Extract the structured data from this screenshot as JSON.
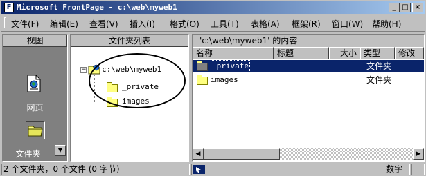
{
  "window": {
    "title": "Microsoft FrontPage - c:\\web\\myweb1",
    "app_icon_glyph": "F",
    "minimize_glyph": "_",
    "maximize_glyph": "□",
    "close_glyph": "×"
  },
  "menu": [
    "文件(F)",
    "编辑(E)",
    "查看(V)",
    "插入(I)",
    "格式(O)",
    "工具(T)",
    "表格(A)",
    "框架(R)",
    "窗口(W)",
    "帮助(H)"
  ],
  "views_bar": {
    "header": "视图",
    "items": [
      {
        "label": "网页",
        "icon": "page-icon"
      },
      {
        "label": "文件夹",
        "icon": "folder-icon",
        "selected": true
      }
    ]
  },
  "folder_list": {
    "header": "文件夹列表",
    "root": {
      "label": "c:\\web\\myweb1",
      "expander": "−"
    },
    "children": [
      {
        "label": "_private"
      },
      {
        "label": "images"
      }
    ]
  },
  "contents": {
    "title": "'c:\\web\\myweb1' 的内容",
    "columns": [
      "名称",
      "标题",
      "大小",
      "类型",
      "修改"
    ],
    "rows": [
      {
        "name": "_private",
        "title": "",
        "size": "",
        "type": "文件夹",
        "selected": true
      },
      {
        "name": "images",
        "title": "",
        "size": "",
        "type": "文件夹",
        "selected": false
      }
    ]
  },
  "scrollbar": {
    "left_arrow": "◀",
    "right_arrow": "▶"
  },
  "status_bar": {
    "summary": "2 个文件夹，0 个文件 (0 字节)",
    "num_indicator": "数字"
  },
  "colors": {
    "title_active": "#0a246a",
    "selection": "#0a246a",
    "folder_fill": "#ffff80"
  }
}
